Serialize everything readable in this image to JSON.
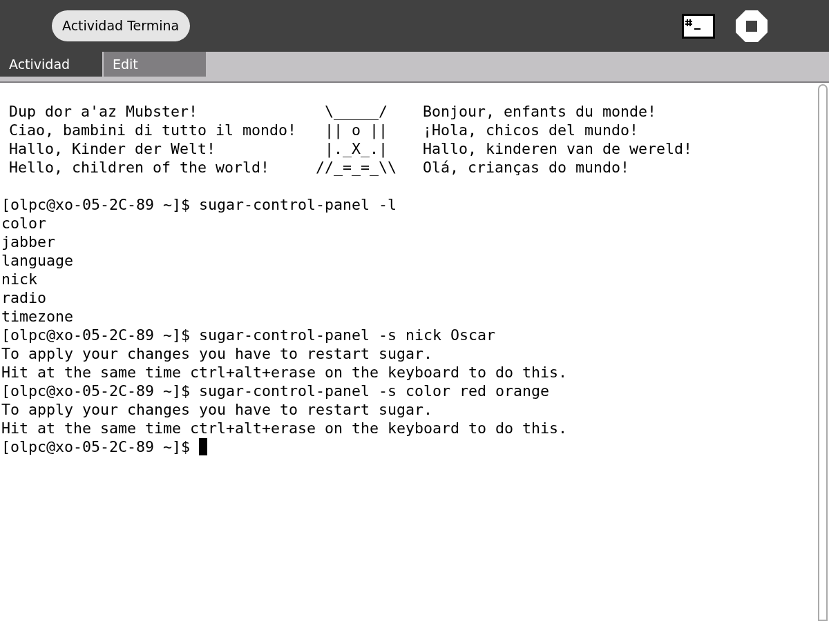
{
  "toolbar": {
    "title": "Actividad Termina"
  },
  "tabs": [
    {
      "label": "Actividad",
      "selected": true
    },
    {
      "label": "Edit",
      "selected": false
    }
  ],
  "terminal": {
    "banner": [
      {
        "left": "Dup dor a'az Mubster!",
        "art": " \\_____/",
        "right": "Bonjour, enfants du monde!"
      },
      {
        "left": "Ciao, bambini di tutto il mondo!",
        "art": " || o ||",
        "right": "¡Hola, chicos del mundo!"
      },
      {
        "left": "Hallo, Kinder der Welt!",
        "art": " |._X_.|",
        "right": "Hallo, kinderen van de wereld!"
      },
      {
        "left": "Hello, children of the world!",
        "art": "//_=_=_\\\\",
        "right": "Olá, crianças do mundo!"
      }
    ],
    "lines": [
      {
        "kind": "command",
        "prompt": "[olpc@xo-05-2C-89 ~]$",
        "text": "sugar-control-panel -l"
      },
      {
        "kind": "output",
        "text": "color"
      },
      {
        "kind": "output",
        "text": "jabber"
      },
      {
        "kind": "output",
        "text": "language"
      },
      {
        "kind": "output",
        "text": "nick"
      },
      {
        "kind": "output",
        "text": "radio"
      },
      {
        "kind": "output",
        "text": "timezone"
      },
      {
        "kind": "command",
        "prompt": "[olpc@xo-05-2C-89 ~]$",
        "text": "sugar-control-panel -s nick Oscar"
      },
      {
        "kind": "output",
        "text": "To apply your changes you have to restart sugar."
      },
      {
        "kind": "output",
        "text": "Hit at the same time ctrl+alt+erase on the keyboard to do this."
      },
      {
        "kind": "command",
        "prompt": "[olpc@xo-05-2C-89 ~]$",
        "text": "sugar-control-panel -s color red orange"
      },
      {
        "kind": "output",
        "text": "To apply your changes you have to restart sugar."
      },
      {
        "kind": "output",
        "text": "Hit at the same time ctrl+alt+erase on the keyboard to do this."
      },
      {
        "kind": "prompt",
        "prompt": "[olpc@xo-05-2C-89 ~]$"
      }
    ]
  }
}
